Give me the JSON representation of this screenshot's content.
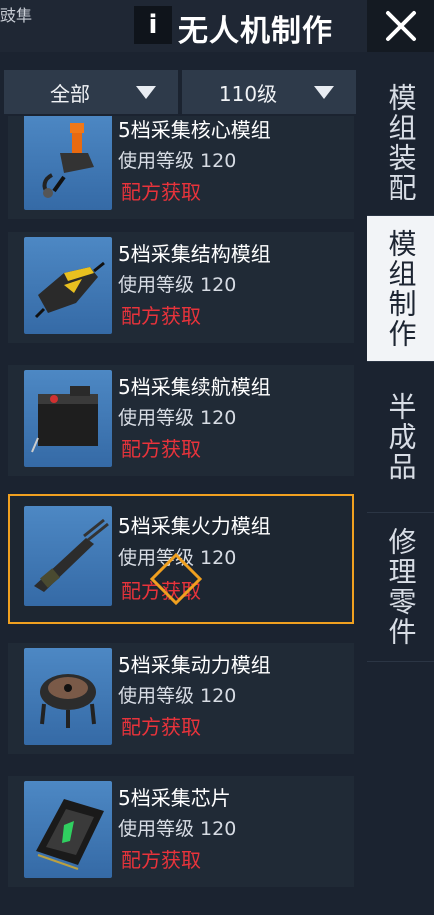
{
  "header": {
    "corner_text": "豉隼",
    "info_label": "i",
    "title": "无人机制作"
  },
  "filters": {
    "category": "全部",
    "level": "110级"
  },
  "items": [
    {
      "name": "5档采集核心模组",
      "level": "使用等级 120",
      "recipe": "配方获取",
      "icon": "drone-core-module-icon"
    },
    {
      "name": "5档采集结构模组",
      "level": "使用等级 120",
      "recipe": "配方获取",
      "icon": "drone-structure-module-icon"
    },
    {
      "name": "5档采集续航模组",
      "level": "使用等级 120",
      "recipe": "配方获取",
      "icon": "battery-module-icon"
    },
    {
      "name": "5档采集火力模组",
      "level": "使用等级 120",
      "recipe": "配方获取",
      "icon": "gun-module-icon"
    },
    {
      "name": "5档采集动力模组",
      "level": "使用等级 120",
      "recipe": "配方获取",
      "icon": "rotor-module-icon"
    },
    {
      "name": "5档采集芯片",
      "level": "使用等级 120",
      "recipe": "配方获取",
      "icon": "chip-icon"
    }
  ],
  "sidebar": {
    "tabs": [
      {
        "label": "模组装配"
      },
      {
        "label": "模组制作"
      },
      {
        "label": "半成品"
      },
      {
        "label": "修理零件"
      }
    ]
  },
  "colors": {
    "accent_selected": "#f0a020",
    "recipe_red": "#e8333b",
    "active_tab_bg": "#f2f4f7"
  }
}
